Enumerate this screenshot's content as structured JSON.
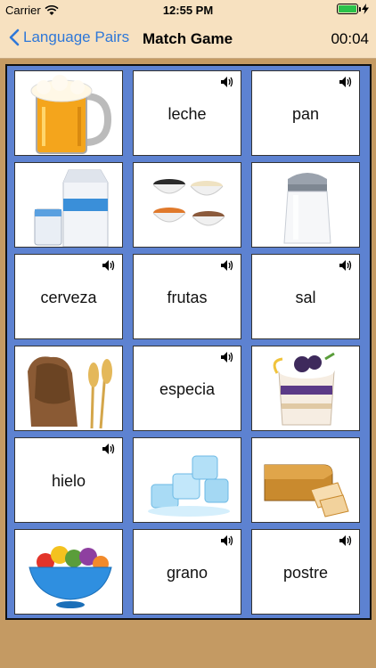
{
  "status": {
    "carrier": "Carrier",
    "time": "12:55 PM",
    "wifi_icon": "wifi-icon",
    "battery_icon": "battery-icon",
    "charging_icon": "bolt-icon"
  },
  "nav": {
    "back_label": "Language Pairs",
    "title": "Match Game",
    "timer": "00:04"
  },
  "colors": {
    "nav_bg": "#f7e1c0",
    "board_bg": "#5d82d1",
    "page_bg": "#c49a63",
    "link": "#2f78d8"
  },
  "cards": [
    {
      "type": "image",
      "icon": "beer-mug-icon"
    },
    {
      "type": "word",
      "text": "leche",
      "audio_icon": "speaker-icon"
    },
    {
      "type": "word",
      "text": "pan",
      "audio_icon": "speaker-icon"
    },
    {
      "type": "image",
      "icon": "milk-carton-icon"
    },
    {
      "type": "image",
      "icon": "spice-bowls-icon"
    },
    {
      "type": "image",
      "icon": "salt-shaker-icon"
    },
    {
      "type": "word",
      "text": "cerveza",
      "audio_icon": "speaker-icon"
    },
    {
      "type": "word",
      "text": "frutas",
      "audio_icon": "speaker-icon"
    },
    {
      "type": "word",
      "text": "sal",
      "audio_icon": "speaker-icon"
    },
    {
      "type": "image",
      "icon": "grain-sack-icon"
    },
    {
      "type": "word",
      "text": "especia",
      "audio_icon": "speaker-icon"
    },
    {
      "type": "image",
      "icon": "dessert-parfait-icon"
    },
    {
      "type": "word",
      "text": "hielo",
      "audio_icon": "speaker-icon"
    },
    {
      "type": "image",
      "icon": "ice-cubes-icon"
    },
    {
      "type": "image",
      "icon": "bread-loaf-icon"
    },
    {
      "type": "image",
      "icon": "fruit-bowl-icon"
    },
    {
      "type": "word",
      "text": "grano",
      "audio_icon": "speaker-icon"
    },
    {
      "type": "word",
      "text": "postre",
      "audio_icon": "speaker-icon"
    }
  ]
}
